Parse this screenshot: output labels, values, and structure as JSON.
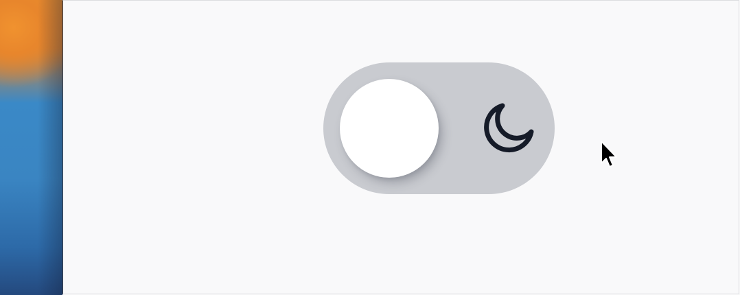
{
  "desktop": {
    "wallpaper": {
      "colors": [
        "#e98e2e",
        "#3a89c7",
        "#24497e"
      ]
    }
  },
  "window": {
    "background": "#f9f9fa"
  },
  "theme_toggle": {
    "state": "light",
    "track_color": "#c9cbd0",
    "knob_color": "#ffffff",
    "icon": "moon-icon",
    "icon_color": "#151b28"
  },
  "pointer": {
    "icon": "arrow-cursor-icon"
  }
}
